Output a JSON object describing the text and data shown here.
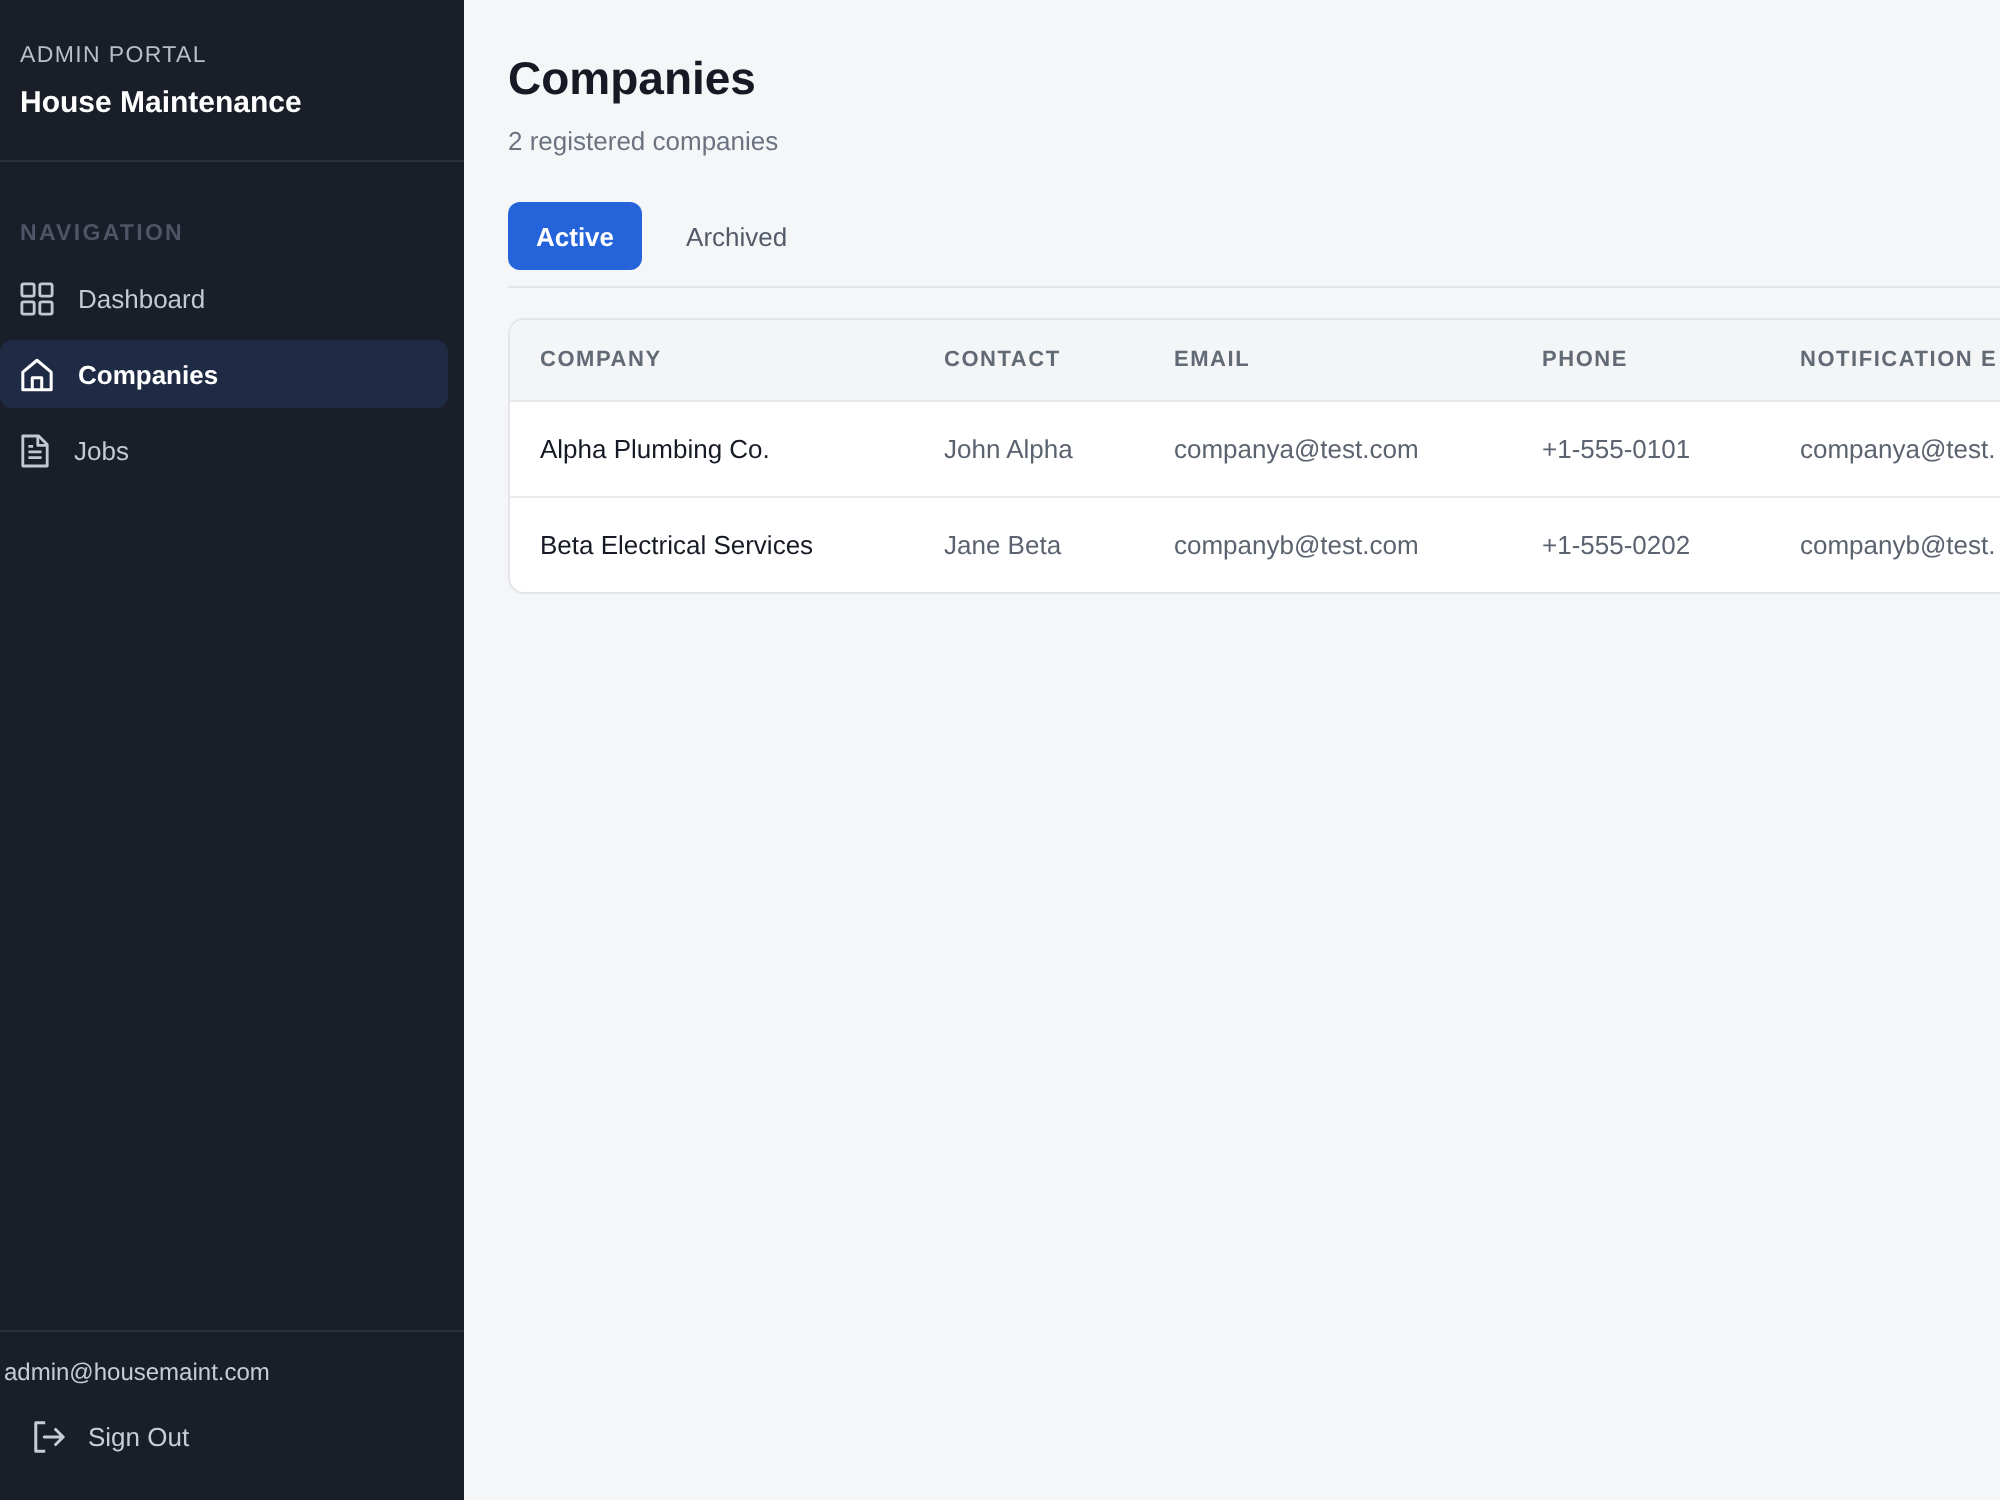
{
  "sidebar": {
    "eyebrow": "ADMIN PORTAL",
    "title": "House Maintenance",
    "section_label": "NAVIGATION",
    "items": [
      {
        "label": "Dashboard",
        "selected": false
      },
      {
        "label": "Companies",
        "selected": true
      },
      {
        "label": "Jobs",
        "selected": false
      }
    ],
    "user_email": "admin@housemaint.com",
    "sign_out": "Sign Out"
  },
  "page": {
    "title": "Companies",
    "subtitle": "2 registered companies"
  },
  "tabs": [
    {
      "label": "Active",
      "selected": true
    },
    {
      "label": "Archived",
      "selected": false
    }
  ],
  "table": {
    "columns": [
      "COMPANY",
      "CONTACT",
      "EMAIL",
      "PHONE",
      "NOTIFICATION E"
    ],
    "rows": [
      [
        "Alpha Plumbing Co.",
        "John Alpha",
        "companya@test.com",
        "+1-555-0101",
        "companya@test."
      ],
      [
        "Beta Electrical Services",
        "Jane Beta",
        "companyb@test.com",
        "+1-555-0202",
        "companyb@test."
      ]
    ]
  }
}
